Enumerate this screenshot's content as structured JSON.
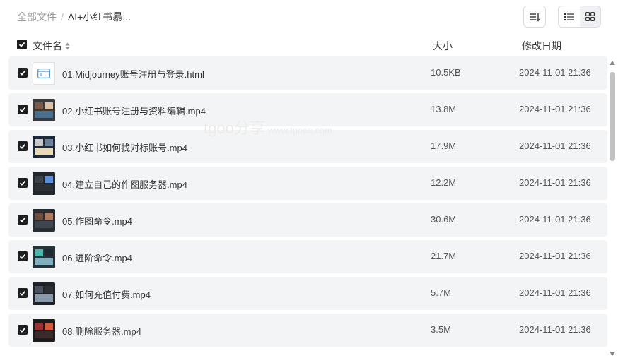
{
  "breadcrumb": {
    "root": "全部文件",
    "separator": "/",
    "current": "AI+小红书暴..."
  },
  "toolbar": {
    "sort_icon": "sort-icon",
    "list_view_icon": "list-view-icon",
    "grid_view_icon": "grid-view-icon",
    "active_view": "list"
  },
  "columns": {
    "name": "文件名",
    "size": "大小",
    "date": "修改日期"
  },
  "watermark": {
    "brand": "tgoo分享",
    "url": "www.tgoos.com"
  },
  "files": [
    {
      "name": "01.Midjourney账号注册与登录.html",
      "size": "10.5KB",
      "date": "2024-11-01 21:36",
      "type": "html",
      "checked": true
    },
    {
      "name": "02.小红书账号注册与资料编辑.mp4",
      "size": "13.8M",
      "date": "2024-11-01 21:36",
      "type": "video",
      "checked": true
    },
    {
      "name": "03.小红书如何找对标账号.mp4",
      "size": "17.9M",
      "date": "2024-11-01 21:36",
      "type": "video",
      "checked": true
    },
    {
      "name": "04.建立自己的作图服务器.mp4",
      "size": "12.2M",
      "date": "2024-11-01 21:36",
      "type": "video",
      "checked": true
    },
    {
      "name": "05.作图命令.mp4",
      "size": "30.6M",
      "date": "2024-11-01 21:36",
      "type": "video",
      "checked": true
    },
    {
      "name": "06.进阶命令.mp4",
      "size": "21.7M",
      "date": "2024-11-01 21:36",
      "type": "video",
      "checked": true
    },
    {
      "name": "07.如何充值付费.mp4",
      "size": "5.7M",
      "date": "2024-11-01 21:36",
      "type": "video",
      "checked": true
    },
    {
      "name": "08.删除服务器.mp4",
      "size": "3.5M",
      "date": "2024-11-01 21:36",
      "type": "video",
      "checked": true
    }
  ]
}
